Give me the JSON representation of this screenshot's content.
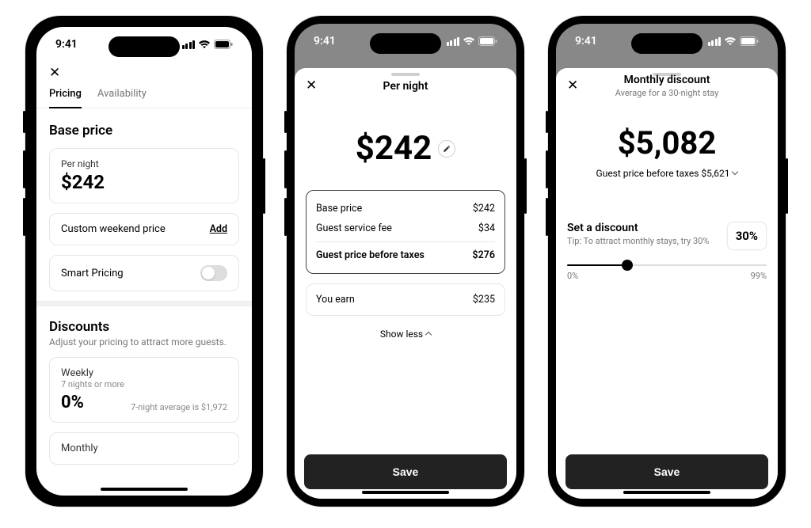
{
  "status": {
    "time": "9:41"
  },
  "phone1": {
    "tabs": {
      "pricing": "Pricing",
      "availability": "Availability"
    },
    "base_price": {
      "title": "Base price",
      "per_night_label": "Per night",
      "per_night_value": "$242",
      "weekend_label": "Custom weekend price",
      "weekend_action": "Add",
      "smart_pricing_label": "Smart Pricing"
    },
    "discounts": {
      "title": "Discounts",
      "subtitle": "Adjust your pricing to attract more guests.",
      "weekly_label": "Weekly",
      "weekly_sub": "7 nights or more",
      "weekly_pct": "0%",
      "weekly_meta": "7-night average is $1,972",
      "monthly_label": "Monthly"
    }
  },
  "phone2": {
    "title": "Per night",
    "hero_price": "$242",
    "breakdown": {
      "base_label": "Base price",
      "base_val": "$242",
      "fee_label": "Guest service fee",
      "fee_val": "$34",
      "total_label": "Guest price before taxes",
      "total_val": "$276"
    },
    "earn_label": "You earn",
    "earn_val": "$235",
    "show_less": "Show less",
    "save": "Save"
  },
  "phone3": {
    "title": "Monthly discount",
    "subtitle": "Average for a 30-night stay",
    "hero_price": "$5,082",
    "pretax_label": "Guest price before taxes $5,621",
    "set_discount_label": "Set a discount",
    "tip": "Tip: To attract monthly stays, try 30%",
    "discount_value": "30%",
    "slider_min": "0%",
    "slider_max": "99%",
    "slider_pct": 30,
    "save": "Save"
  }
}
